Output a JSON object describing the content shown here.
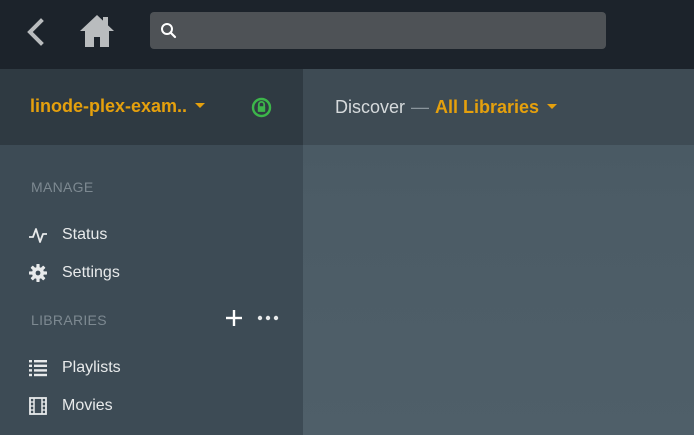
{
  "topbar": {
    "back_icon": "chevron-left-icon",
    "home_icon": "home-icon",
    "search": {
      "icon": "search-icon",
      "value": "",
      "placeholder": ""
    }
  },
  "sidebar": {
    "server": {
      "name": "linode-plex-exam..",
      "status_icon": "lock-icon",
      "status_color": "#3cb54a",
      "accent": "#e5a00d"
    },
    "manage": {
      "heading": "MANAGE",
      "items": [
        {
          "label": "Status",
          "icon": "activity-icon"
        },
        {
          "label": "Settings",
          "icon": "gear-icon"
        }
      ]
    },
    "libraries": {
      "heading": "LIBRARIES",
      "add_icon": "plus-icon",
      "more_icon": "ellipsis-icon",
      "items": [
        {
          "label": "Playlists",
          "icon": "list-icon"
        },
        {
          "label": "Movies",
          "icon": "film-icon"
        }
      ]
    }
  },
  "main": {
    "breadcrumb": {
      "section": "Discover",
      "separator": "—",
      "current": "All Libraries"
    }
  }
}
